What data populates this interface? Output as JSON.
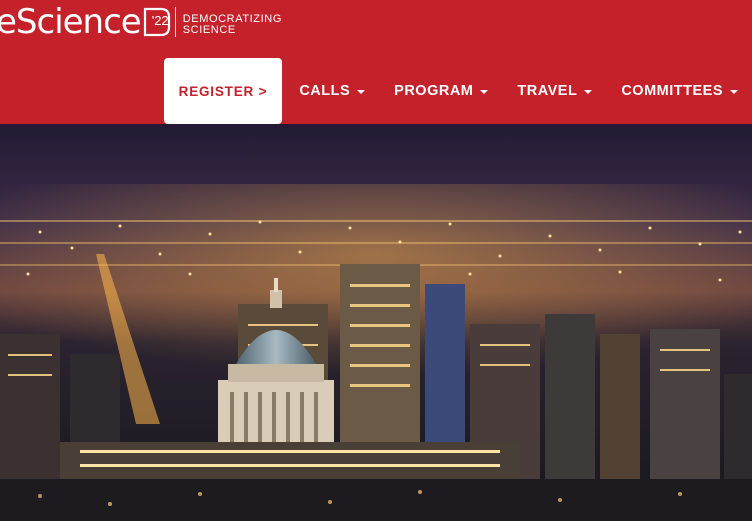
{
  "logo": {
    "wordmark": "eScience",
    "year": "'22",
    "tagline_line1": "DEMOCRATIZING",
    "tagline_line2": "SCIENCE"
  },
  "nav": {
    "register": "REGISTER >",
    "calls": "CALLS",
    "program": "PROGRAM",
    "travel": "TRAVEL",
    "committees": "COMMITTEES"
  },
  "hero": {
    "image": "night-city-skyline-capitol-dome"
  },
  "colors": {
    "brand_red": "#c4212b",
    "white": "#ffffff"
  }
}
